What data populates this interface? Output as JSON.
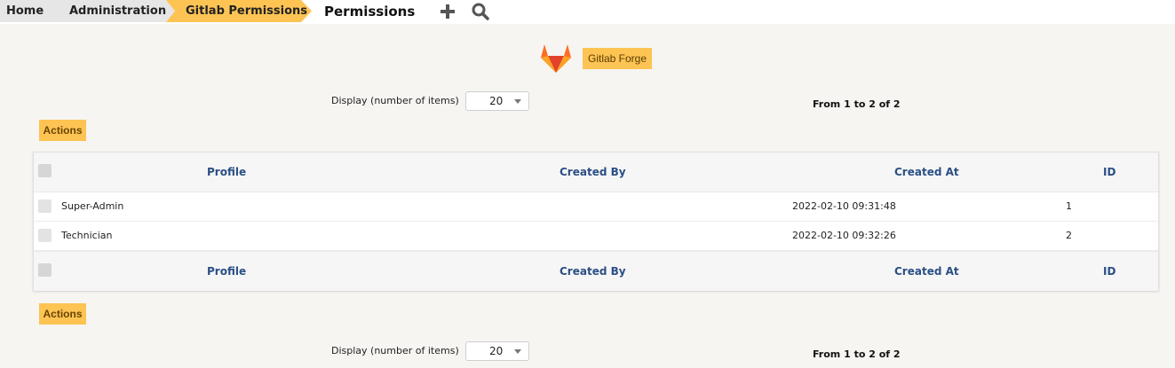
{
  "breadcrumb": {
    "home": "Home",
    "administration": "Administration",
    "gitlab_permissions": "Gitlab Permissions"
  },
  "page": {
    "title": "Permissions"
  },
  "toolbar": {
    "add_icon": "plus-icon",
    "search_icon": "search-icon"
  },
  "forge": {
    "logo_icon": "gitlab-logo-icon",
    "label": "Gitlab Forge"
  },
  "pagination_top": {
    "display_label": "Display (number of items)",
    "per_page": "20",
    "range": "From 1 to 2 of 2"
  },
  "pagination_bottom": {
    "display_label": "Display (number of items)",
    "per_page": "20",
    "range": "From 1 to 2 of 2"
  },
  "actions_label": "Actions",
  "table": {
    "columns": [
      "Profile",
      "Created By",
      "Created At",
      "ID"
    ],
    "rows": [
      {
        "profile": "Super-Admin",
        "created_by": "",
        "created_at": "2022-02-10 09:31:48",
        "id": "1"
      },
      {
        "profile": "Technician",
        "created_by": "",
        "created_at": "2022-02-10 09:32:26",
        "id": "2"
      }
    ]
  },
  "colors": {
    "accent_yellow": "#fdc454",
    "header_text_blue": "#2a4f84",
    "breadcrumb_grey": "#e8e8e8"
  }
}
